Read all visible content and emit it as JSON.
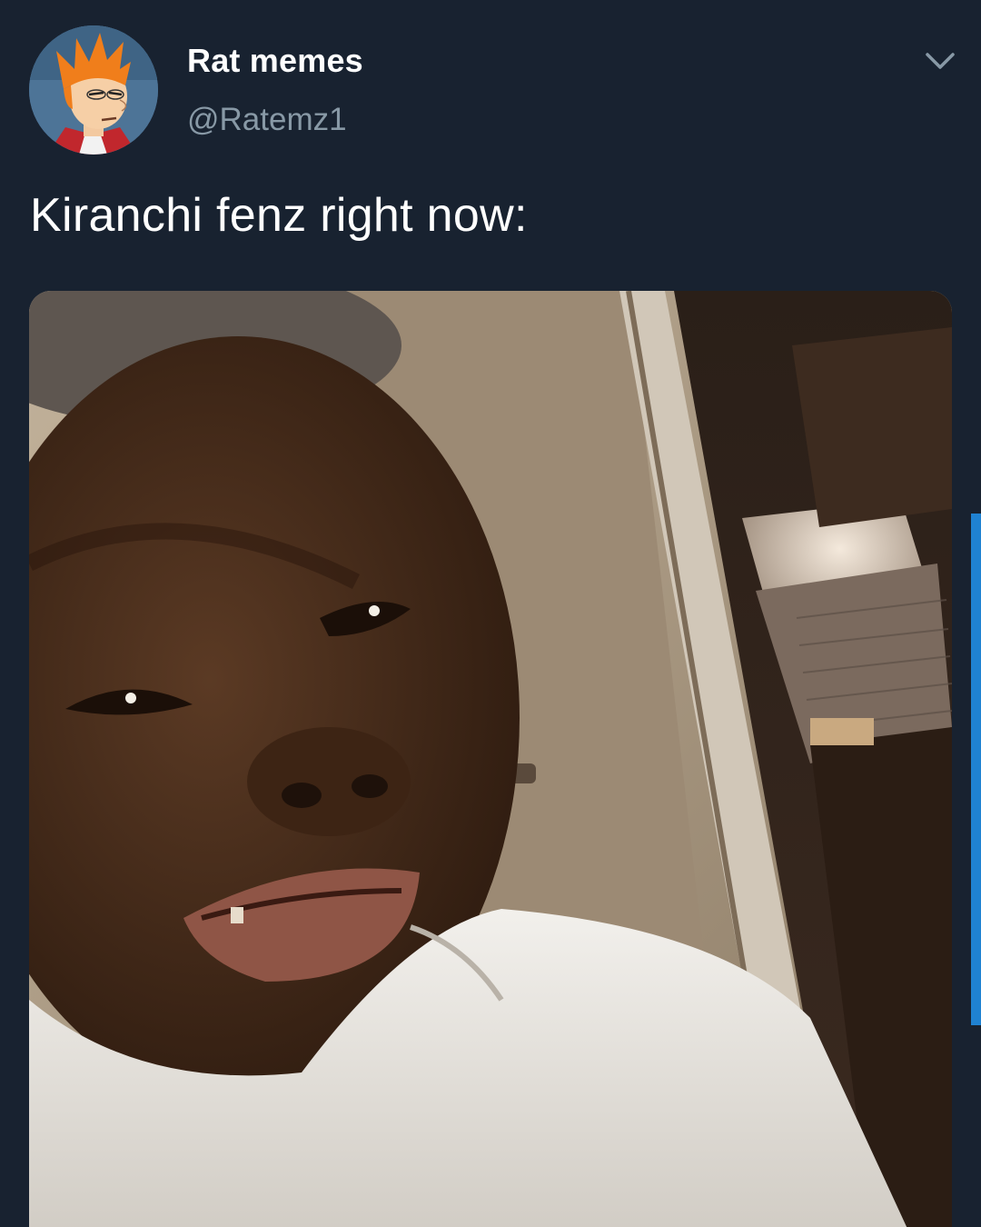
{
  "tweet": {
    "display_name": "Rat memes",
    "handle": "@Ratemz1",
    "text": "Kiranchi fenz right now:",
    "avatar_icon": "cartoon-avatar-icon",
    "menu_icon": "chevron-down-icon"
  },
  "colors": {
    "background": "#182230",
    "handle": "#8899a6",
    "scrollbar": "#1f82d2"
  }
}
